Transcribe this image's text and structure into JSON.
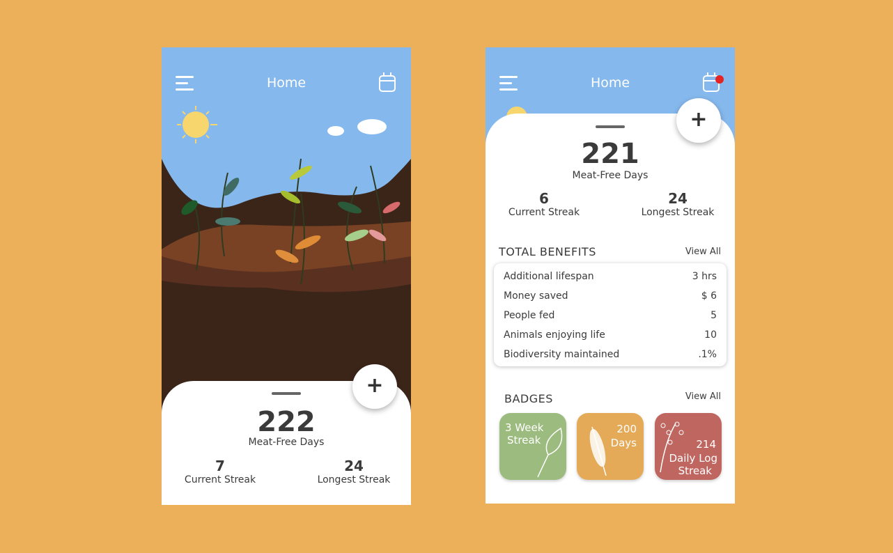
{
  "screen1": {
    "title": "Home",
    "total": "222",
    "total_label": "Meat-Free Days",
    "current_streak": "7",
    "current_label": "Current Streak",
    "longest_streak": "24",
    "longest_label": "Longest Streak",
    "add": "+"
  },
  "screen2": {
    "title": "Home",
    "total": "221",
    "total_label": "Meat-Free Days",
    "current_streak": "6",
    "current_label": "Current Streak",
    "longest_streak": "24",
    "longest_label": "Longest Streak",
    "add": "+",
    "benefits_title": "TOTAL BENEFITS",
    "benefits_view_all": "View All",
    "benefits": [
      {
        "label": "Additional lifespan",
        "value": "3 hrs"
      },
      {
        "label": "Money saved",
        "value": "$ 6"
      },
      {
        "label": "People fed",
        "value": "5"
      },
      {
        "label": "Animals enjoying life",
        "value": "10"
      },
      {
        "label": "Biodiversity maintained",
        "value": ".1%"
      }
    ],
    "badges_title": "BADGES",
    "badges_view_all": "View All",
    "badges": [
      {
        "l1": "3 Week",
        "l2": "Streak",
        "color": "#9cbb7e"
      },
      {
        "l1": "200",
        "l2": "Days",
        "color": "#e5aa58"
      },
      {
        "l1": "214",
        "l2": "Daily Log",
        "l3": "Streak",
        "color": "#bf6660"
      }
    ]
  },
  "colors": {
    "background": "#ecaf5a",
    "sky": "#85b8ec",
    "notification": "#e52323"
  }
}
